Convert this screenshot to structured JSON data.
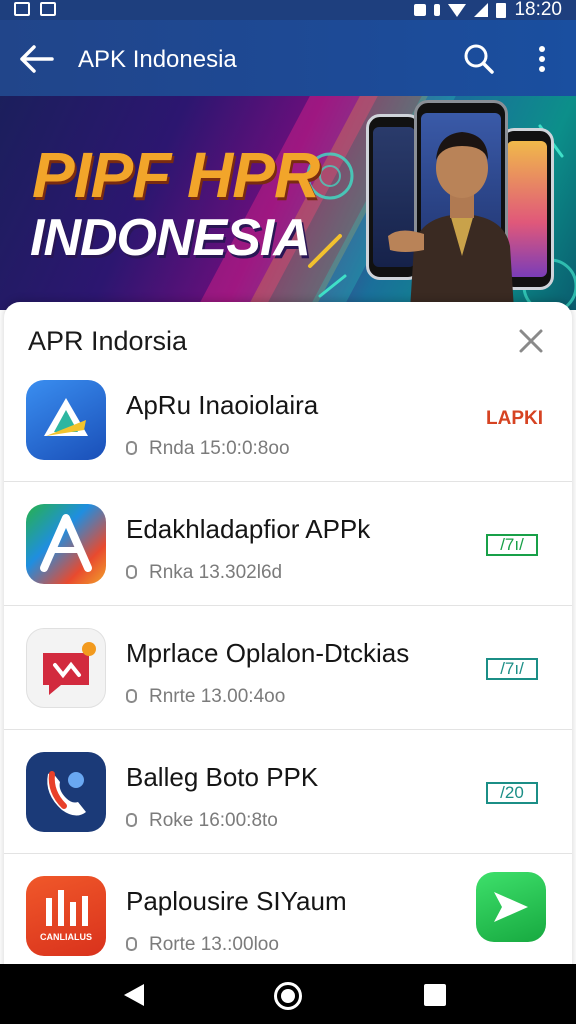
{
  "status_bar": {
    "time": "18:20",
    "icons": [
      "notification-icon",
      "clipboard-icon",
      "alarm-icon",
      "bluetooth-icon",
      "wifi-icon",
      "signal-icon",
      "battery-icon"
    ]
  },
  "app_bar": {
    "title": "APK Indonesia",
    "back_icon": "arrow-left-icon",
    "search_icon": "search-icon",
    "more_icon": "more-vertical-icon"
  },
  "banner": {
    "title_line1": "PIPF HPR",
    "title_line2": "INDONESIA"
  },
  "sheet": {
    "title": "APR Indorsia",
    "close_icon": "close-icon",
    "items": [
      {
        "title": "ApRu Inaoiolaira",
        "subtitle": "Rnda  15:0:0:8oo",
        "badge": "LAPKI",
        "badge_style": "text",
        "icon": "app-logo-blue-triangle-icon",
        "accent": "#2f6fd6"
      },
      {
        "title": "Edakhladapfior APPk",
        "subtitle": "Rnka  13.302l6d",
        "badge": "/7ı/",
        "badge_style": "green",
        "icon": "app-logo-multicolor-a-icon",
        "accent": "#1fa54f"
      },
      {
        "title": "Mprlace Oplalon-Dtckias",
        "subtitle": "Rnrte  13.00:4oo",
        "badge": "/7ı/",
        "badge_style": "teal",
        "icon": "app-logo-red-chat-icon",
        "accent": "#d22a3e"
      },
      {
        "title": "Balleg Boto PPK",
        "subtitle": "Roke  16:00:8to",
        "badge": "/20",
        "badge_style": "teal",
        "icon": "app-logo-phone-icon",
        "accent": "#1b3a78"
      },
      {
        "title": "Paplousire SIYaum",
        "subtitle": "Rorte  13.:00loo",
        "badge": "",
        "badge_style": "share",
        "icon": "app-logo-orange-bars-icon",
        "accent": "#e8421f"
      }
    ],
    "icon_captions": {
      "item5": "CANLIALUS"
    }
  },
  "nav_bar": {
    "back_icon": "nav-back-icon",
    "home_icon": "nav-home-icon",
    "recents_icon": "nav-recents-icon"
  },
  "colors": {
    "app_bar": "#1d4a96",
    "banner_accent_orange": "#f2a52a",
    "badge_red": "#d64322",
    "badge_green": "#18a048",
    "badge_teal": "#1b8e86"
  }
}
